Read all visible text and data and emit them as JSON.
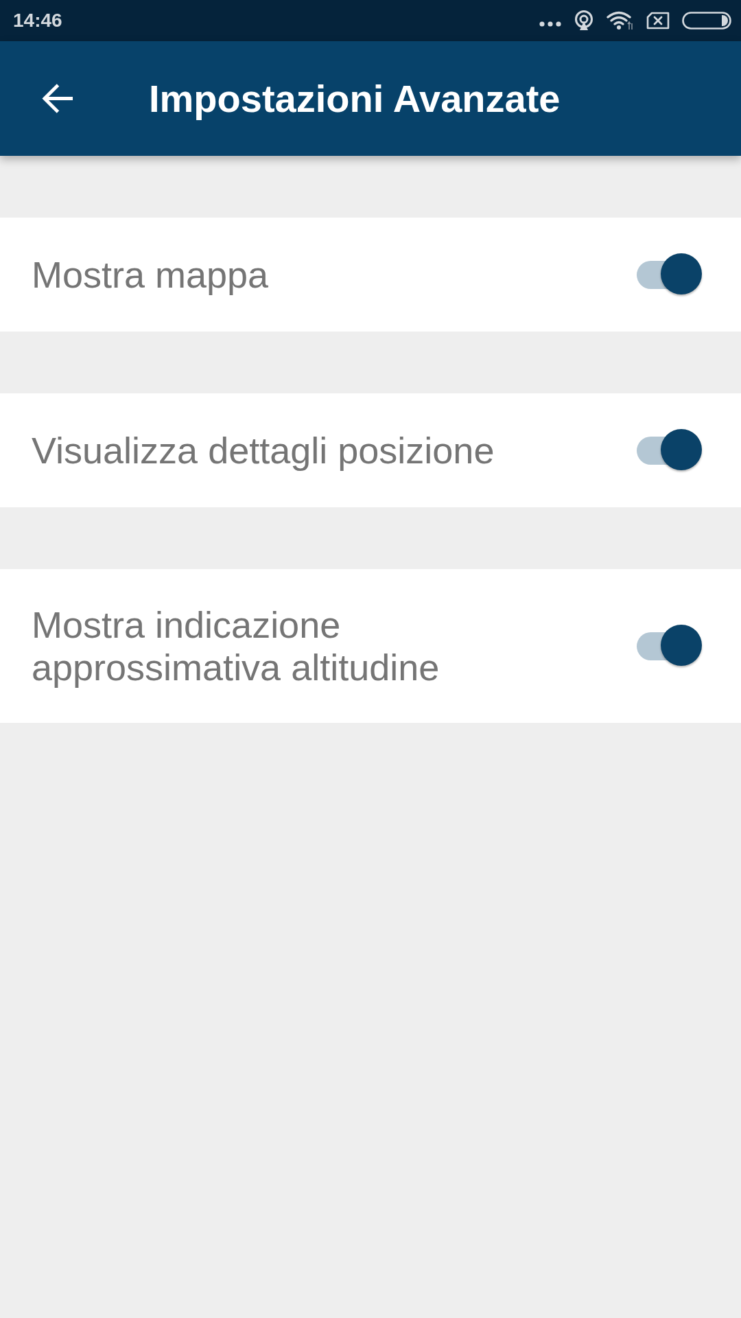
{
  "status_bar": {
    "time": "14:46"
  },
  "app_bar": {
    "title": "Impostazioni Avanzate"
  },
  "settings": [
    {
      "label": "Mostra mappa",
      "on": true
    },
    {
      "label": "Visualizza dettagli posizione",
      "on": true
    },
    {
      "label": "Mostra indicazione approssimativa altitudine",
      "on": true
    }
  ]
}
